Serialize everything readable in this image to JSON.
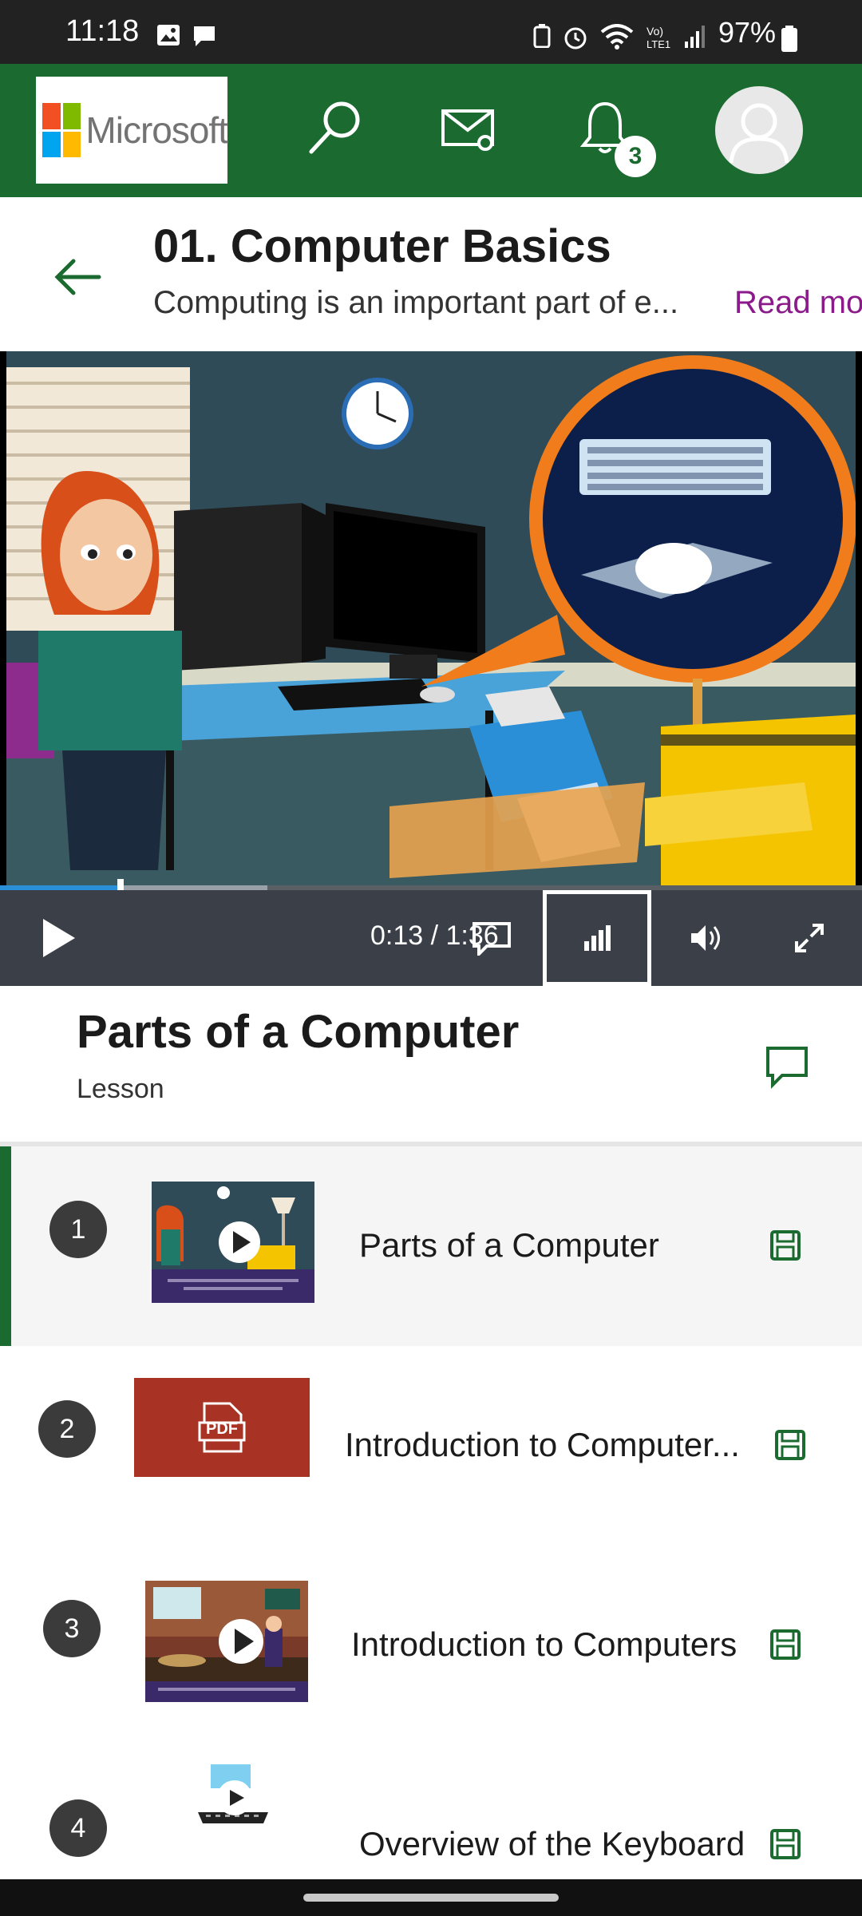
{
  "status_bar": {
    "time": "11:18",
    "battery": "97%",
    "icons": [
      "image-icon",
      "chat-icon",
      "battery-saver-icon",
      "alarm-icon",
      "wifi-icon",
      "volte-icon",
      "signal-icon",
      "battery-icon"
    ]
  },
  "header": {
    "logo_text": "Microsoft",
    "notification_count": "3",
    "colors": {
      "brand_green": "#1b6b31"
    }
  },
  "course": {
    "title": "01. Computer Basics",
    "description": "Computing is an important part of e...",
    "read_more": "Read mo"
  },
  "player": {
    "time": "0:13 / 1:36",
    "progress_fraction": 0.14,
    "buffered_fraction": 0.31
  },
  "lesson": {
    "title": "Parts of a Computer",
    "type": "Lesson"
  },
  "items": [
    {
      "number": "1",
      "label": "Parts of a Computer",
      "kind": "video",
      "active": true
    },
    {
      "number": "2",
      "label": "Introduction to Computer...",
      "kind": "pdf",
      "thumb_text": "PDF",
      "active": false
    },
    {
      "number": "3",
      "label": "Introduction to Computers",
      "kind": "video",
      "active": false
    },
    {
      "number": "4",
      "label": "Overview of the Keyboard",
      "kind": "video",
      "active": false
    }
  ]
}
